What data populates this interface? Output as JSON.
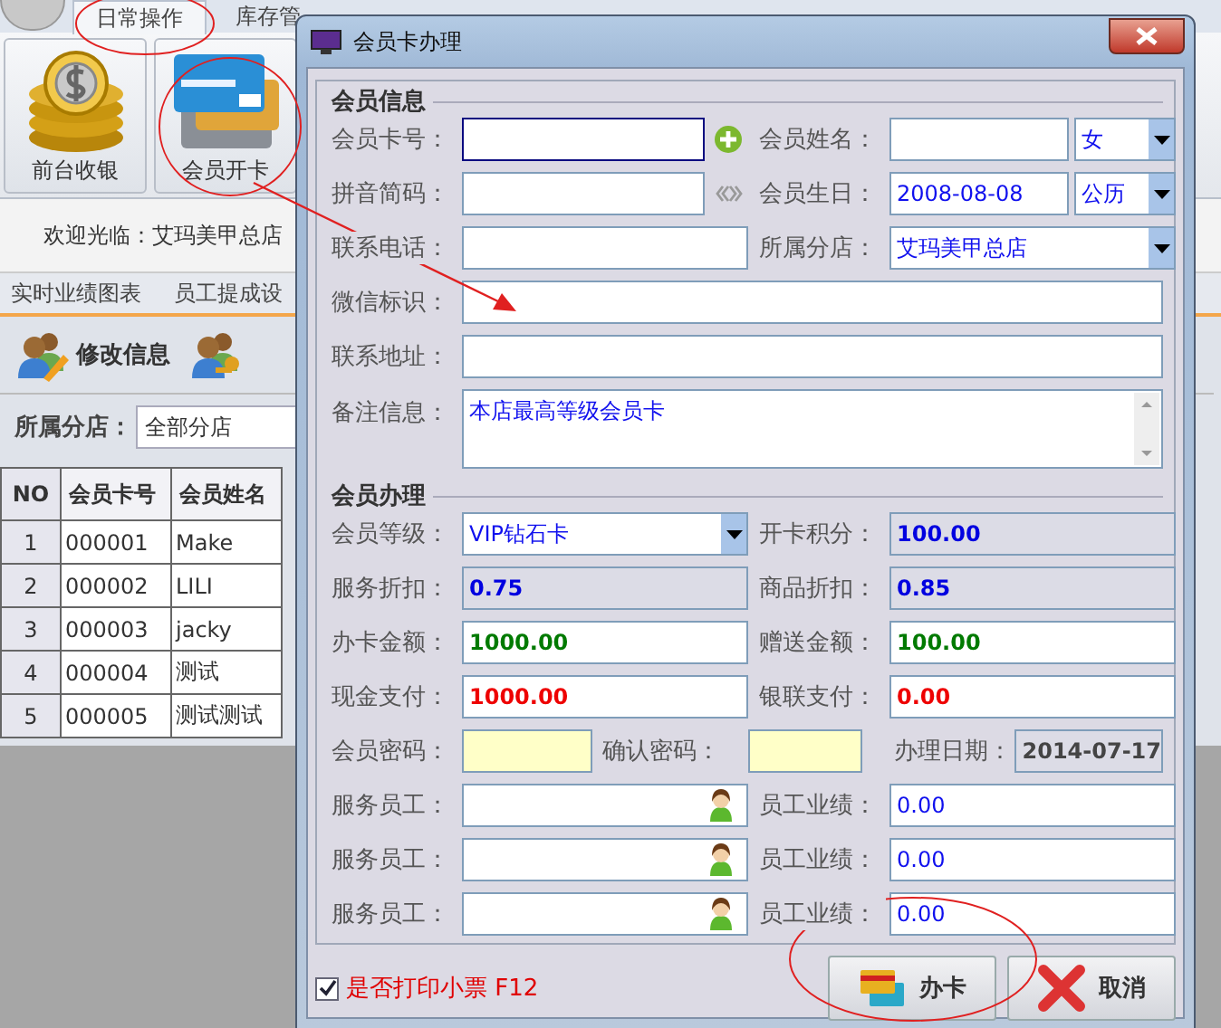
{
  "app": {
    "tabs": [
      {
        "label": "日常操作",
        "selected": true
      },
      {
        "label": "库存管",
        "selected": false
      }
    ],
    "ribbon": [
      {
        "label": "前台收银"
      },
      {
        "label": "会员开卡"
      }
    ],
    "welcome": "欢迎光临：艾玛美甲总店",
    "subtabs": [
      {
        "label": "实时业绩图表"
      },
      {
        "label": "员工提成设"
      }
    ],
    "toolbar": [
      {
        "label": "修改信息"
      }
    ],
    "filter": {
      "label": "所属分店：",
      "value": "全部分店"
    },
    "table": {
      "columns": [
        "NO",
        "会员卡号",
        "会员姓名"
      ],
      "rows": [
        [
          "1",
          "000001",
          "Make"
        ],
        [
          "2",
          "000002",
          "LILI"
        ],
        [
          "3",
          "000003",
          "jacky"
        ],
        [
          "4",
          "000004",
          "测试"
        ],
        [
          "5",
          "000005",
          "测试测试"
        ]
      ]
    }
  },
  "dialog": {
    "title": "会员卡办理",
    "info": {
      "title": "会员信息",
      "rows": [
        [
          {
            "label": "会员卡号：",
            "kind": "text",
            "focused": true
          },
          {
            "label": "会员姓名：",
            "kind": "text",
            "select": "女"
          }
        ],
        [
          {
            "label": "拼音简码：",
            "kind": "text"
          },
          {
            "label": "会员生日：",
            "kind": "text",
            "value": "2008-08-08",
            "select": "公历"
          }
        ],
        [
          {
            "label": "联系电话：",
            "kind": "text"
          },
          {
            "label": "所属分店：",
            "kind": "dropdown",
            "value": "艾玛美甲总店"
          }
        ],
        [
          {
            "label": "微信标识：",
            "kind": "text"
          }
        ],
        [
          {
            "label": "联系地址：",
            "kind": "text"
          }
        ],
        [
          {
            "label": "备注信息：",
            "kind": "textarea",
            "value": "本店最高等级会员卡"
          }
        ]
      ]
    },
    "membership": {
      "title": "会员办理",
      "rows": [
        [
          {
            "label": "会员等级：",
            "kind": "dropdown",
            "value": "VIP钻石卡"
          },
          {
            "label": "开卡积分：",
            "kind": "readonly",
            "value": "100.00"
          }
        ],
        [
          {
            "label": "服务折扣：",
            "kind": "readonly",
            "value": "0.75"
          },
          {
            "label": "商品折扣：",
            "kind": "readonly",
            "value": "0.85"
          }
        ],
        [
          {
            "label": "办卡金额：",
            "kind": "amount",
            "value": "1000.00"
          },
          {
            "label": "赠送金额：",
            "kind": "amount",
            "value": "100.00"
          }
        ],
        [
          {
            "label": "现金支付：",
            "kind": "payment",
            "value": "1000.00"
          },
          {
            "label": "银联支付：",
            "kind": "payment",
            "value": "0.00"
          }
        ],
        [
          {
            "label": "会员密码：",
            "kind": "password"
          },
          {
            "label": "确认密码：",
            "kind": "password"
          },
          {
            "label": "办理日期：",
            "kind": "date",
            "value": "2014-07-17"
          }
        ],
        [
          {
            "label": "服务员工：",
            "kind": "staff"
          },
          {
            "label": "员工业绩：",
            "kind": "text",
            "value": "0.00"
          }
        ],
        [
          {
            "label": "服务员工：",
            "kind": "staff"
          },
          {
            "label": "员工业绩：",
            "kind": "text",
            "value": "0.00"
          }
        ],
        [
          {
            "label": "服务员工：",
            "kind": "staff"
          },
          {
            "label": "员工业绩：",
            "kind": "text",
            "value": "0.00"
          }
        ]
      ]
    },
    "print": {
      "label": "是否打印小票 F12",
      "checked": true
    },
    "buttons": [
      {
        "label": "办卡",
        "kind": "card"
      },
      {
        "label": "取消",
        "kind": "cancel"
      }
    ]
  }
}
